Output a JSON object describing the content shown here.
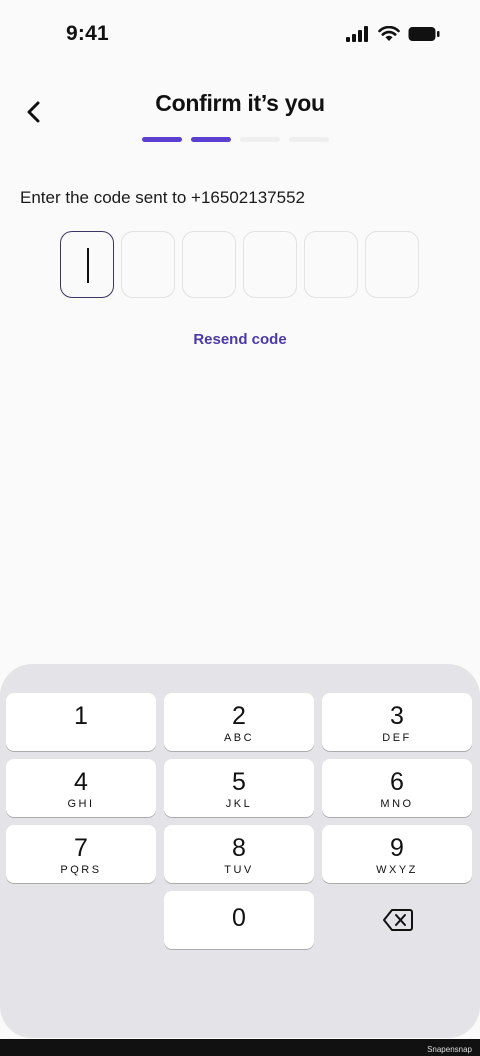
{
  "status_bar": {
    "time": "9:41"
  },
  "header": {
    "title": "Confirm it’s you"
  },
  "progress": {
    "step_colors": [
      "#5b3fd0",
      "#5b3fd0",
      "#efefef",
      "#efefef"
    ]
  },
  "form": {
    "instruction": "Enter the code sent to +16502137552",
    "code_length": 6,
    "resend_label": "Resend code"
  },
  "keypad": {
    "keys": [
      {
        "digit": "1",
        "letters": ""
      },
      {
        "digit": "2",
        "letters": "ABC"
      },
      {
        "digit": "3",
        "letters": "DEF"
      },
      {
        "digit": "4",
        "letters": "GHI"
      },
      {
        "digit": "5",
        "letters": "JKL"
      },
      {
        "digit": "6",
        "letters": "MNO"
      },
      {
        "digit": "7",
        "letters": "PQRS"
      },
      {
        "digit": "8",
        "letters": "TUV"
      },
      {
        "digit": "9",
        "letters": "WXYZ"
      },
      {
        "digit": "0",
        "letters": ""
      }
    ],
    "backspace_icon": "backspace-icon"
  },
  "footer": {
    "watermark": "Snapensnap"
  },
  "colors": {
    "accent": "#4a3aa8",
    "progress_active": "#5b3fd0",
    "keyboard_bg": "#e4e4e8"
  }
}
